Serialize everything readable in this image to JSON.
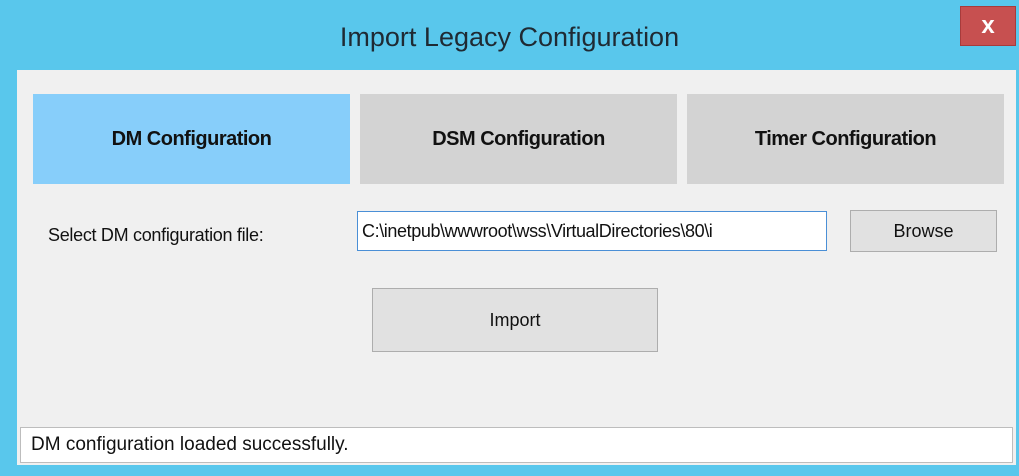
{
  "window": {
    "title": "Import Legacy Configuration",
    "close_label": "x"
  },
  "tabs": [
    {
      "label": "DM Configuration",
      "selected": true
    },
    {
      "label": "DSM Configuration",
      "selected": false
    },
    {
      "label": "Timer Configuration",
      "selected": false
    }
  ],
  "form": {
    "file_label": "Select DM configuration file:",
    "file_path_value": "C:\\inetpub\\wwwroot\\wss\\VirtualDirectories\\80\\i",
    "browse_label": "Browse",
    "import_label": "Import"
  },
  "status": {
    "message": "DM configuration loaded successfully."
  },
  "colors": {
    "window_frame": "#59c7ec",
    "selected_tab": "#87cefa",
    "unselected_tab": "#d3d3d3",
    "close_button": "#c75050",
    "client_background": "#f0f0f0"
  }
}
